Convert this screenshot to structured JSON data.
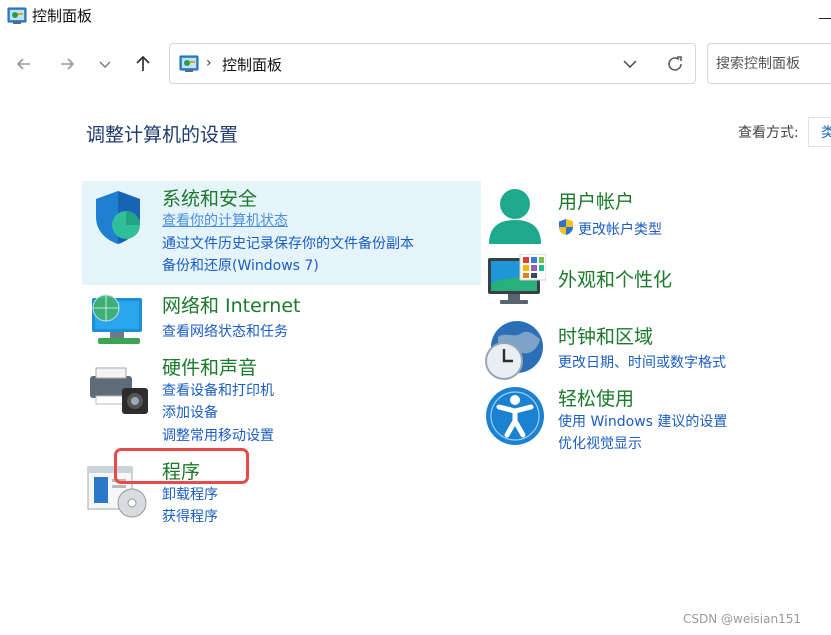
{
  "window": {
    "title": "控制面板"
  },
  "address": {
    "path": "控制面板",
    "separator": "›"
  },
  "search": {
    "placeholder": "搜索控制面板"
  },
  "page": {
    "heading": "调整计算机的设置",
    "view_by_label": "查看方式:",
    "view_by_value": "类别"
  },
  "categories": {
    "system_security": {
      "title": "系统和安全",
      "links": [
        "查看你的计算机状态",
        "通过文件历史记录保存你的文件备份副本",
        "备份和还原(Windows 7)"
      ]
    },
    "network": {
      "title": "网络和 Internet",
      "links": [
        "查看网络状态和任务"
      ]
    },
    "hardware": {
      "title": "硬件和声音",
      "links": [
        "查看设备和打印机",
        "添加设备",
        "调整常用移动设置"
      ]
    },
    "programs": {
      "title": "程序",
      "links": [
        "卸载程序",
        "获得程序"
      ]
    },
    "user_accounts": {
      "title": "用户帐户",
      "links": [
        "更改帐户类型"
      ]
    },
    "appearance": {
      "title": "外观和个性化",
      "links": []
    },
    "clock_region": {
      "title": "时钟和区域",
      "links": [
        "更改日期、时间或数字格式"
      ]
    },
    "ease_of_access": {
      "title": "轻松使用",
      "links": [
        "使用 Windows 建议的设置",
        "优化视觉显示"
      ]
    }
  },
  "watermark": {
    "text": "CSDN @weisian151"
  },
  "icons": {
    "title": "control-panel-icon",
    "back": "arrow-left-icon",
    "forward": "arrow-right-icon",
    "recent": "chevron-down-icon",
    "up": "arrow-up-icon",
    "refresh": "refresh-icon",
    "uac": "uac-shield-icon"
  },
  "colors": {
    "category_title": "#1a7a2a",
    "link": "#1a5dc4",
    "heading": "#1e3a6e",
    "selected_bg": "#e5f3fb",
    "annotation_red": "#e74a4a"
  }
}
